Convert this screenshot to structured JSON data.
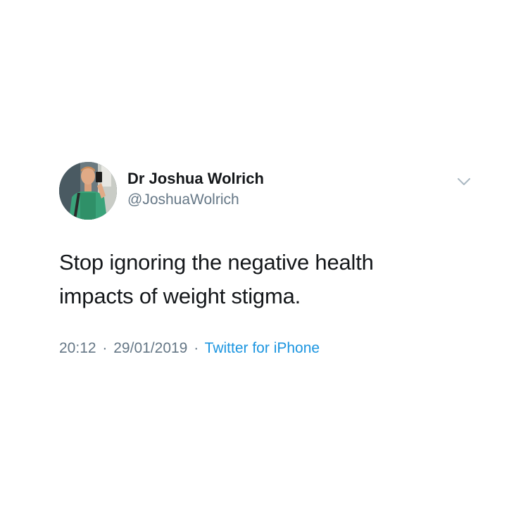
{
  "tweet": {
    "author": {
      "name": "Dr Joshua Wolrich",
      "handle": "@JoshuaWolrich"
    },
    "text_lines": [
      "Stop ignoring the negative health",
      "impacts of weight stigma."
    ],
    "meta": {
      "time": "20:12",
      "date": "29/01/2019",
      "separator": "·",
      "source": "Twitter for iPhone"
    },
    "menu_icon": "chevron-down-icon"
  },
  "colors": {
    "background": "#ffffff",
    "name": "#14171a",
    "secondary": "#657786",
    "link": "#1b95e0",
    "chevron": "#aab8c2"
  }
}
